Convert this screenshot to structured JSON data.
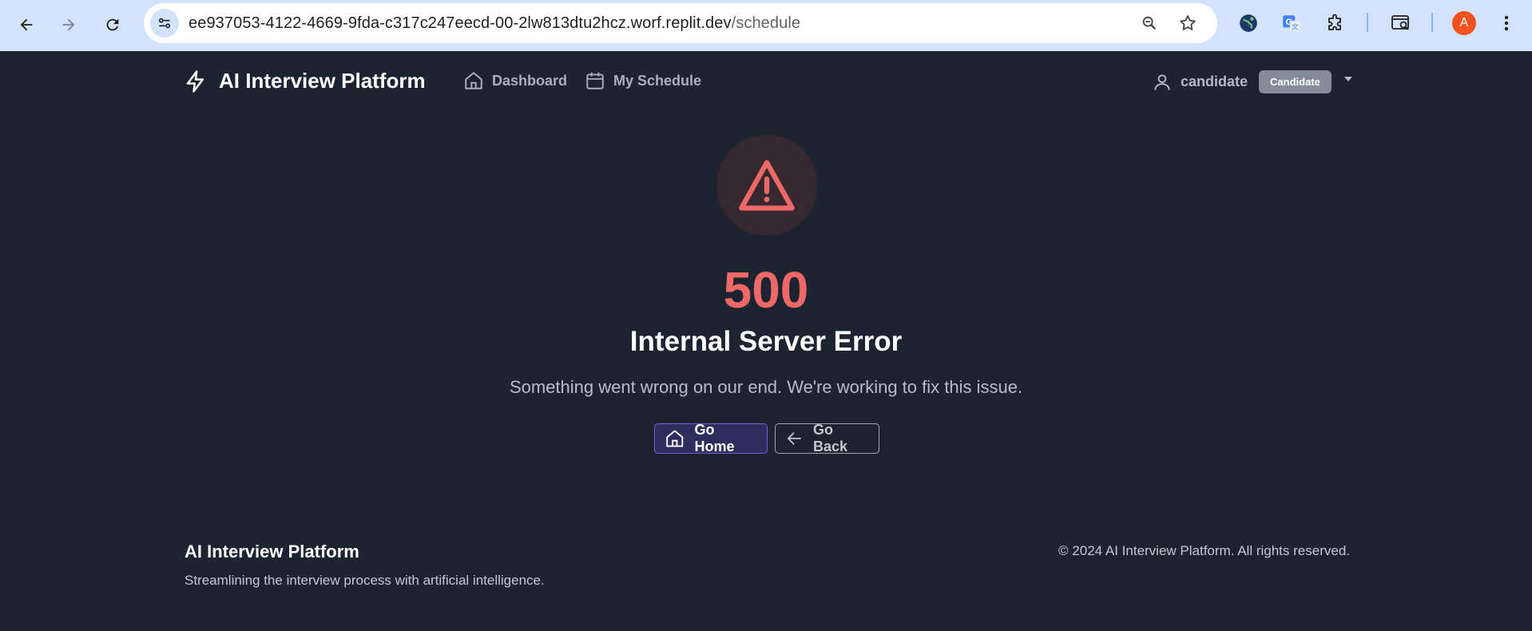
{
  "browser": {
    "url_host": "ee937053-4122-4669-9fda-c317c247eecd-00-2lw813dtu2hcz.worf.replit.dev",
    "url_path": "/schedule",
    "profile_initial": "A",
    "icons": [
      "back-arrow-icon",
      "forward-arrow-icon",
      "reload-icon",
      "site-info-icon",
      "zoom-icon",
      "bookmark-star-icon",
      "globe-extension-icon",
      "translate-extension-icon",
      "extensions-puzzle-icon",
      "search-tab-icon"
    ]
  },
  "header": {
    "brand_title": "AI Interview Platform",
    "nav": [
      {
        "label": "Dashboard",
        "icon": "home-icon"
      },
      {
        "label": "My Schedule",
        "icon": "calendar-icon"
      }
    ],
    "user": {
      "name": "candidate",
      "role": "Candidate"
    }
  },
  "error": {
    "code": "500",
    "title": "Internal Server Error",
    "message": "Something went wrong on our end. We're working to fix this issue.",
    "home_label": "Go Home",
    "back_label": "Go Back"
  },
  "footer": {
    "title": "AI Interview Platform",
    "tagline": "Streamlining the interview process with artificial intelligence.",
    "copyright": "© 2024 AI Interview Platform. All rights reserved."
  },
  "colors": {
    "page_bg": "#1e2332",
    "error_red": "#ee6868",
    "accent": "#6b64d0",
    "chrome_bg": "#d3e3fd"
  }
}
